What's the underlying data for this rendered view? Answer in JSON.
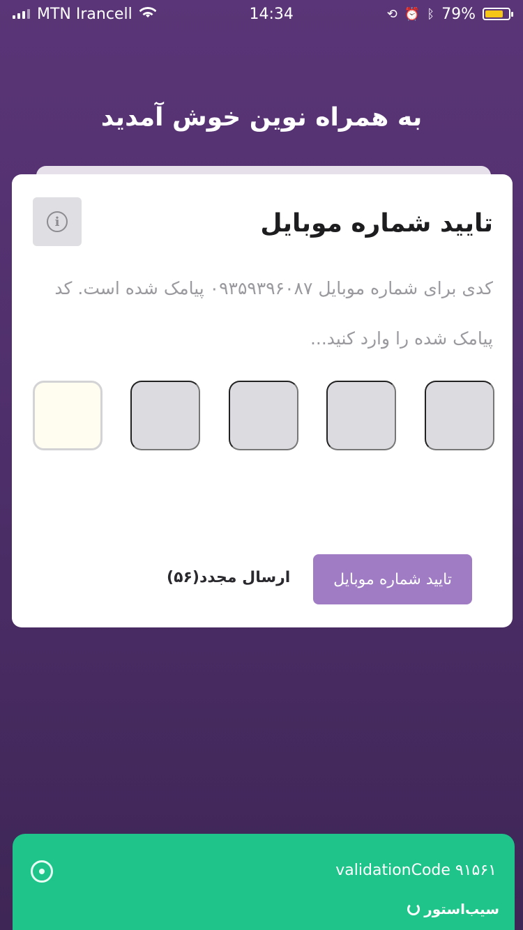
{
  "status_bar": {
    "carrier": "MTN Irancell",
    "time": "14:34",
    "battery_percent": "79%",
    "battery_level": 0.79
  },
  "welcome_title": "به همراه نوین خوش آمدید",
  "card": {
    "title": "تایید شماره موبایل",
    "description": "کدی برای شماره موبایل ۰۹۳۵۹۳۹۶۰۸۷ پیامک شده است. کد پیامک شده را وارد کنید...",
    "code_boxes": [
      "",
      "",
      "",
      "",
      ""
    ],
    "confirm_label": "تایید شماره موبایل",
    "resend_label": "ارسال مجدد(۵۶)"
  },
  "toast": {
    "message": "validationCode ۹۱۵۶۱"
  },
  "watermark": "سیب‌استور",
  "colors": {
    "background": "#54306f",
    "accent_button": "#a07cc4",
    "toast": "#1ec48a",
    "card": "#ffffff"
  },
  "icons": {
    "info": "info-icon",
    "wifi": "wifi-icon",
    "close": "close-icon"
  }
}
